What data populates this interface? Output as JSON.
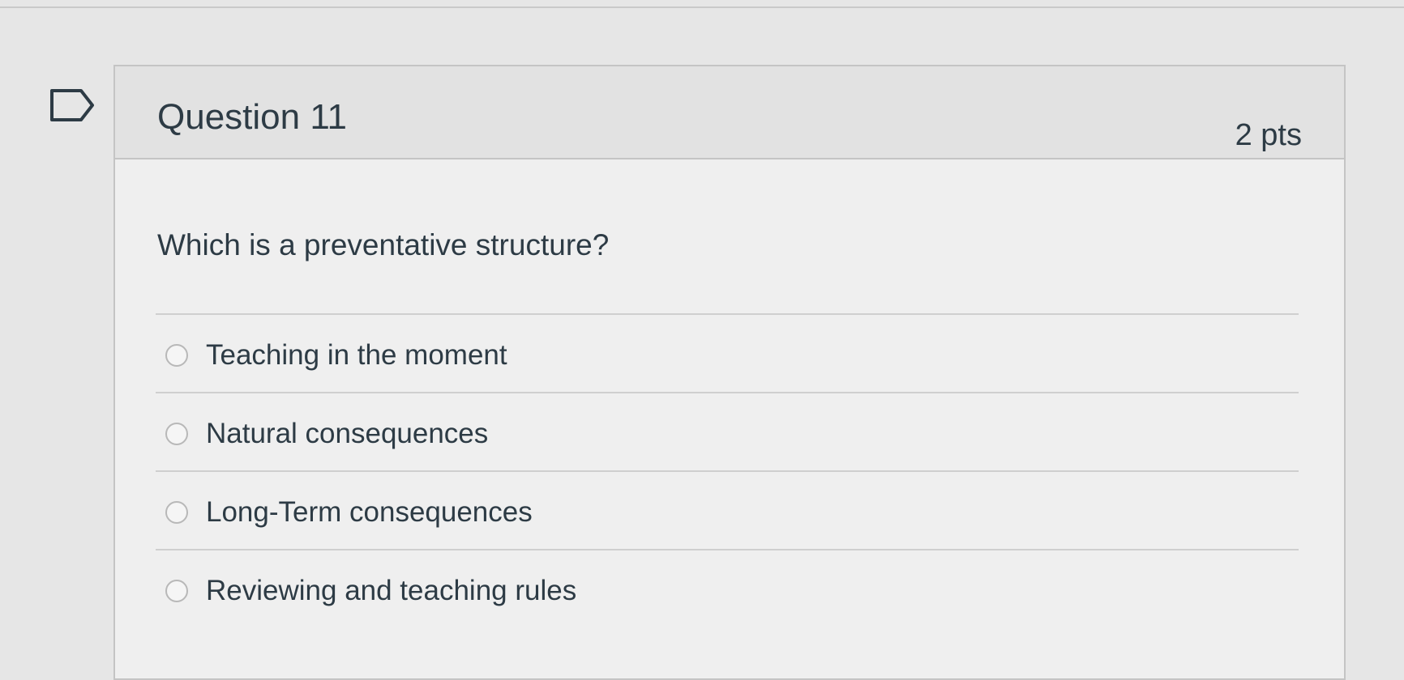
{
  "question": {
    "title": "Question 11",
    "points": "2 pts",
    "text": "Which is a preventative structure?",
    "answers": [
      {
        "label": "Teaching in the moment"
      },
      {
        "label": "Natural consequences"
      },
      {
        "label": "Long-Term consequences"
      },
      {
        "label": "Reviewing and teaching rules"
      }
    ]
  },
  "icons": {
    "bookmark": "bookmark-flag-icon",
    "radio": "radio-button"
  }
}
